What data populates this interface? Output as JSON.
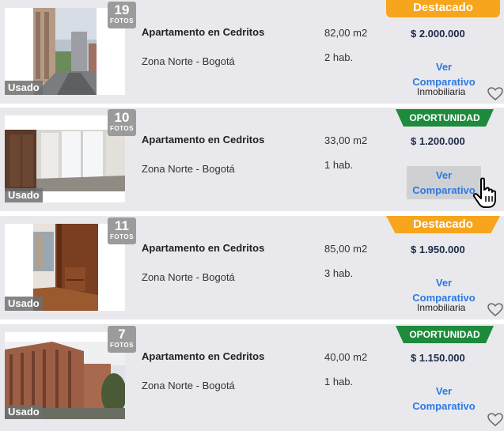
{
  "listings": [
    {
      "photo_count": "19",
      "photos_label": "FOTOS",
      "condition": "Usado",
      "title": "Apartamento en Cedritos",
      "zone": "Zona Norte - Bogotá",
      "area": "82,00 m2",
      "rooms": "2 hab.",
      "price": "$ 2.000.000",
      "compare_line1": "Ver",
      "compare_line2": "Comparativo",
      "agency": "Inmobiliaria",
      "badge": "Destacado"
    },
    {
      "photo_count": "10",
      "photos_label": "FOTOS",
      "condition": "Usado",
      "title": "Apartamento en Cedritos",
      "zone": "Zona Norte - Bogotá",
      "area": "33,00 m2",
      "rooms": "1 hab.",
      "price": "$ 1.200.000",
      "compare_line1": "Ver",
      "compare_line2": "Comparativo",
      "badge": "OPORTUNIDAD"
    },
    {
      "photo_count": "11",
      "photos_label": "FOTOS",
      "condition": "Usado",
      "title": "Apartamento en Cedritos",
      "zone": "Zona Norte - Bogotá",
      "area": "85,00 m2",
      "rooms": "3 hab.",
      "price": "$ 1.950.000",
      "compare_line1": "Ver",
      "compare_line2": "Comparativo",
      "agency": "Inmobiliaria",
      "badge": "Destacado"
    },
    {
      "photo_count": "7",
      "photos_label": "FOTOS",
      "condition": "Usado",
      "title": "Apartamento en Cedritos",
      "zone": "Zona Norte - Bogotá",
      "area": "40,00 m2",
      "rooms": "1 hab.",
      "price": "$ 1.150.000",
      "compare_line1": "Ver",
      "compare_line2": "Comparativo",
      "badge": "OPORTUNIDAD"
    }
  ],
  "colors": {
    "featured": "#f7a51c",
    "opportunity": "#1e8a3c",
    "link": "#2a7ae2",
    "price": "#1b2a4a",
    "row_background": "#e9e9ed"
  },
  "icons": [
    "heart-icon",
    "hand-pointer-cursor-icon"
  ]
}
